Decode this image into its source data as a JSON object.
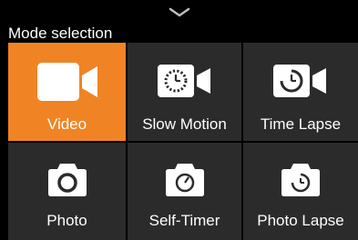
{
  "header": {
    "title": "Mode selection",
    "collapse_icon": "chevron-down-icon"
  },
  "colors": {
    "accent": "#f08424",
    "tile_bg": "#2b2b2b",
    "background": "#000000",
    "text": "#ffffff"
  },
  "modes": [
    {
      "label": "Video",
      "icon": "video-camera-icon",
      "selected": true
    },
    {
      "label": "Slow Motion",
      "icon": "slow-motion-camera-icon",
      "selected": false
    },
    {
      "label": "Time Lapse",
      "icon": "time-lapse-camera-icon",
      "selected": false
    },
    {
      "label": "Photo",
      "icon": "photo-camera-icon",
      "selected": false
    },
    {
      "label": "Self-Timer",
      "icon": "self-timer-camera-icon",
      "selected": false
    },
    {
      "label": "Photo Lapse",
      "icon": "photo-lapse-camera-icon",
      "selected": false
    }
  ]
}
